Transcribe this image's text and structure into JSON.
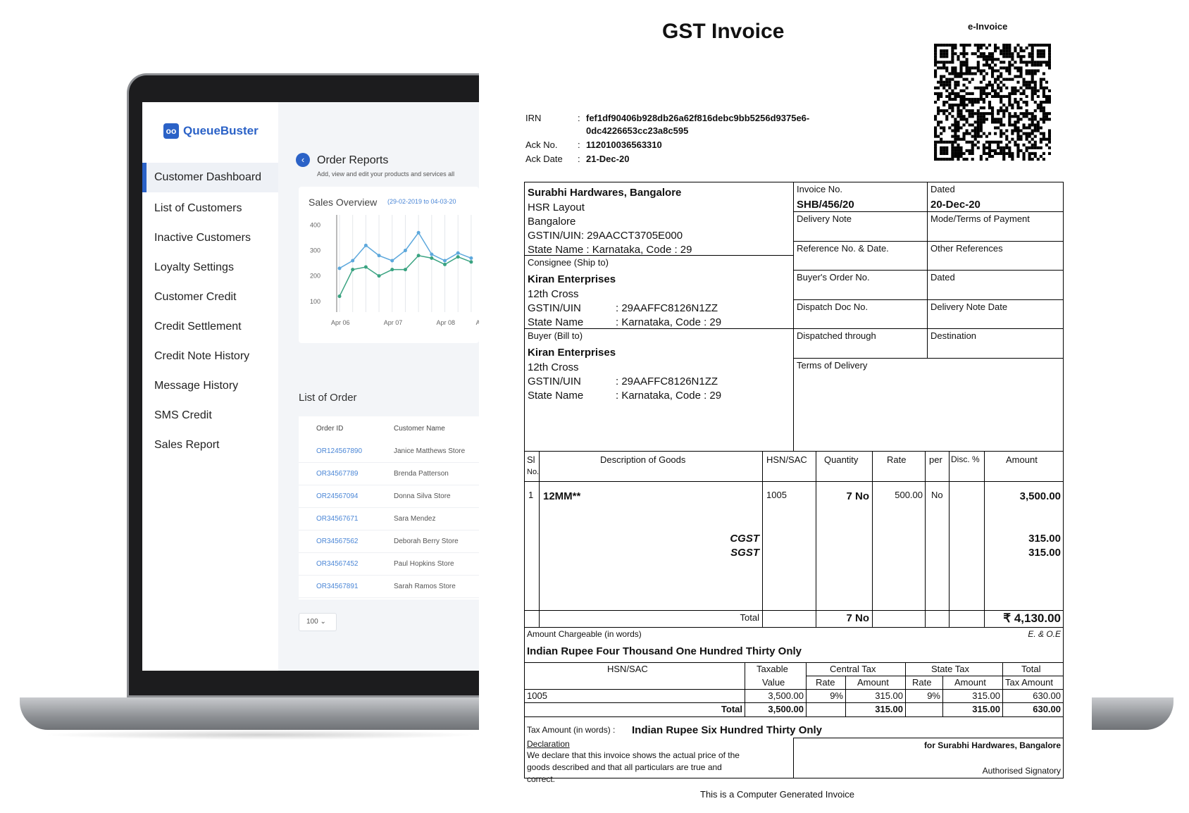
{
  "laptop": {
    "logo_mark": "oo",
    "logo_text": "QueueBuster",
    "sidebar": [
      "Customer Dashboard",
      "List of Customers",
      "Inactive Customers",
      "Loyalty Settings",
      "Customer Credit",
      "Credit Settlement",
      "Credit Note History",
      "Message History",
      "SMS Credit",
      "Sales Report"
    ],
    "page_title": "Order Reports",
    "page_subtitle": "Add, view and edit your products and services all",
    "sales_title": "Sales Overview",
    "sales_range": "(29-02-2019 to 04-03-20",
    "list_title": "List of Order",
    "table_headers": [
      "Order ID",
      "Customer Name"
    ],
    "orders": [
      {
        "id": "OR124567890",
        "customer": "Janice Matthews Store"
      },
      {
        "id": "OR34567789",
        "customer": "Brenda Patterson"
      },
      {
        "id": "OR24567094",
        "customer": "Donna Silva Store"
      },
      {
        "id": "OR34567671",
        "customer": "Sara Mendez"
      },
      {
        "id": "OR34567562",
        "customer": "Deborah Berry Store"
      },
      {
        "id": "OR34567452",
        "customer": "Paul Hopkins Store"
      },
      {
        "id": "OR34567891",
        "customer": "Sarah Ramos Store"
      }
    ],
    "page_size": "100",
    "chart_data": {
      "type": "line",
      "title": "Sales Overview",
      "x": [
        "Apr 06",
        "",
        "",
        "",
        "Apr 07",
        "",
        "",
        "",
        "Apr 08",
        "",
        ""
      ],
      "x_tick_labels": [
        "Apr 06",
        "Apr 07",
        "Apr 08",
        "A"
      ],
      "y_ticks": [
        "400",
        "300",
        "200",
        "100"
      ],
      "ylim": [
        80,
        440
      ],
      "series": [
        {
          "values": [
            230,
            260,
            320,
            280,
            260,
            300,
            370,
            285,
            260,
            290,
            270
          ],
          "color": "#5da8dc"
        },
        {
          "values": [
            120,
            225,
            235,
            200,
            225,
            225,
            280,
            270,
            245,
            275,
            255
          ],
          "color": "#3aa381"
        }
      ],
      "grid": true
    }
  },
  "invoice": {
    "title": "GST Invoice",
    "einvoice": "e-Invoice",
    "irn_label": "IRN",
    "irn_value_1": "fef1df90406b928db26a62f816debc9bb5256d9375e6-",
    "irn_value_2": "0dc4226653cc23a8c595",
    "ack_no_label": "Ack No.",
    "ack_no": "112010036563310",
    "ack_date_label": "Ack Date",
    "ack_date": "21-Dec-20",
    "colon": ":",
    "seller": {
      "name": "Surabhi Hardwares, Bangalore",
      "line1": "HSR Layout",
      "line2": "Bangalore",
      "gstin": "GSTIN/UIN: 29AACCT3705E000",
      "state": "State Name :  Karnataka, Code : 29"
    },
    "consignee_label": "Consignee (Ship to)",
    "buyer_label": "Buyer (Bill to)",
    "party": {
      "name": "Kiran Enterprises",
      "line1": "12th Cross",
      "gstin_label": "GSTIN/UIN",
      "gstin": ":  29AAFFC8126N1ZZ",
      "state_label": "State Name",
      "state": ":  Karnataka, Code : 29"
    },
    "meta": {
      "invoice_no_label": "Invoice No.",
      "invoice_no": "SHB/456/20",
      "dated_label": "Dated",
      "dated": "20-Dec-20",
      "delivery_note": "Delivery Note",
      "mode_terms": "Mode/Terms of Payment",
      "ref_no": "Reference No. & Date.",
      "other_refs": "Other References",
      "buyer_order": "Buyer's Order No.",
      "dated2": "Dated",
      "dispatch_doc": "Dispatch Doc No.",
      "delivery_note_date": "Delivery Note Date",
      "dispatched_through": "Dispatched through",
      "destination": "Destination",
      "terms_delivery": "Terms of Delivery"
    },
    "items_head": {
      "sl": "Sl",
      "no": "No.",
      "desc": "Description of Goods",
      "hsn": "HSN/SAC",
      "qty": "Quantity",
      "rate": "Rate",
      "per": "per",
      "disc": "Disc. %",
      "amount": "Amount"
    },
    "item": {
      "sl": "1",
      "desc": "12MM**",
      "hsn": "1005",
      "qty": "7 No",
      "rate": "500.00",
      "per": "No",
      "amount": "3,500.00"
    },
    "cgst_label": "CGST",
    "sgst_label": "SGST",
    "cgst_amount": "315.00",
    "sgst_amount": "315.00",
    "total_label": "Total",
    "total_qty": "7 No",
    "total_amount": "₹ 4,130.00",
    "amount_words_label": "Amount Chargeable (in words)",
    "eoe": "E. & O.E",
    "amount_words": "Indian Rupee Four Thousand One Hundred Thirty Only",
    "tax_head": {
      "hsn": "HSN/SAC",
      "taxable": "Taxable",
      "value": "Value",
      "central": "Central Tax",
      "state": "State Tax",
      "rate": "Rate",
      "amount": "Amount",
      "total": "Total",
      "tax_amount": "Tax Amount"
    },
    "tax_row": {
      "hsn": "1005",
      "taxable": "3,500.00",
      "c_rate": "9%",
      "c_amt": "315.00",
      "s_rate": "9%",
      "s_amt": "315.00",
      "total": "630.00"
    },
    "tax_total": {
      "label": "Total",
      "taxable": "3,500.00",
      "c_amt": "315.00",
      "s_amt": "315.00",
      "total": "630.00"
    },
    "tax_words_label": "Tax Amount (in words)  :",
    "tax_words": "Indian Rupee Six Hundred Thirty Only",
    "declaration_label": "Declaration",
    "declaration_1": "We declare that this invoice shows the actual price of the",
    "declaration_2": "goods described and that all particulars are true and",
    "declaration_3": "correct.",
    "for_company": "for Surabhi Hardwares, Bangalore",
    "signatory": "Authorised Signatory",
    "footer": "This is a Computer Generated Invoice"
  }
}
